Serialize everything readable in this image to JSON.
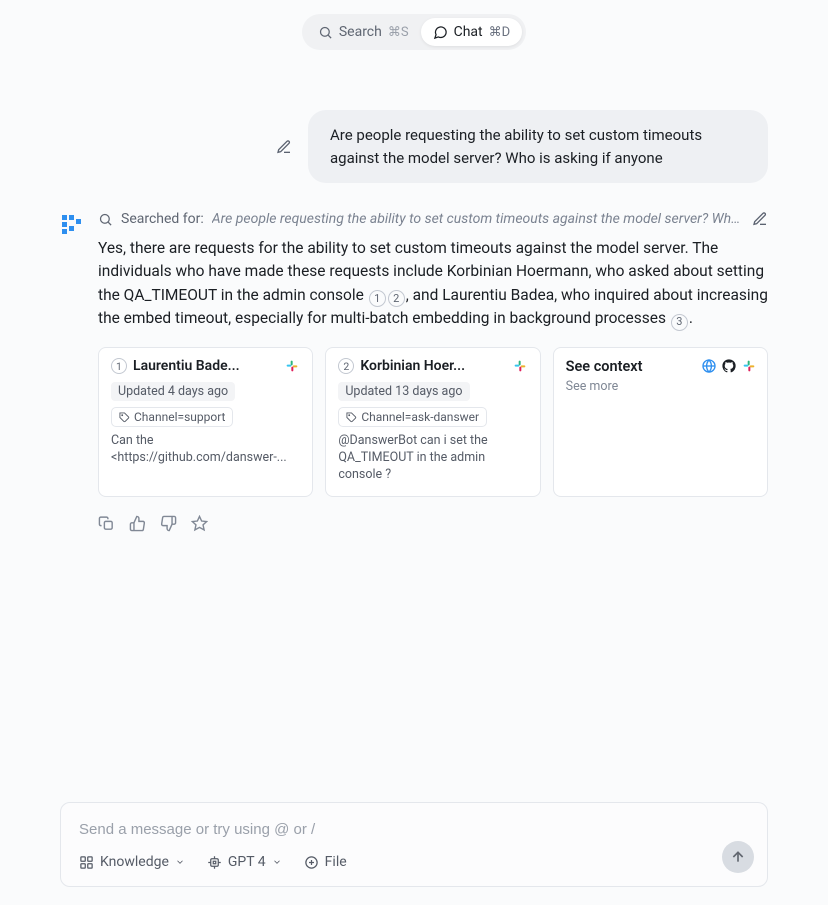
{
  "topbar": {
    "search_label": "Search",
    "search_shortcut": "⌘S",
    "chat_label": "Chat",
    "chat_shortcut": "⌘D"
  },
  "user_message": "Are people requesting the ability to set custom timeouts against the model server? Who is asking if anyone",
  "search": {
    "label": "Searched for:",
    "query": "Are people requesting the ability to set custom timeouts against the model server? Who..."
  },
  "answer": {
    "part1": "Yes, there are requests for the ability to set custom timeouts against the model server. The individuals who have made these requests include Korbinian Hoermann, who asked about setting the QA_TIMEOUT in the admin console ",
    "c1": "1",
    "c2": "2",
    "part2": ", and Laurentiu Badea, who inquired about increasing the embed timeout, especially for multi-batch embedding in background processes ",
    "c3": "3",
    "part3": "."
  },
  "cards": [
    {
      "num": "1",
      "title": "Laurentiu Bade...",
      "updated": "Updated 4 days ago",
      "channel": "Channel=support",
      "body": "Can the <https://github.com/danswer-..."
    },
    {
      "num": "2",
      "title": "Korbinian Hoer...",
      "updated": "Updated 13 days ago",
      "channel": "Channel=ask-danswer",
      "body": "@DanswerBot can i set the QA_TIMEOUT in the admin console ?"
    }
  ],
  "context": {
    "title": "See context",
    "sub": "See more"
  },
  "composer": {
    "placeholder": "Send a message or try using @ or /",
    "knowledge": "Knowledge",
    "model": "GPT 4",
    "file": "File"
  }
}
